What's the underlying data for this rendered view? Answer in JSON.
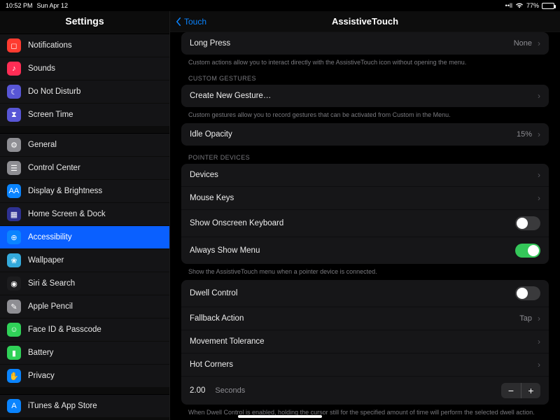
{
  "status": {
    "time": "10:52 PM",
    "date": "Sun Apr 12",
    "battery": "77%"
  },
  "sidebar": {
    "title": "Settings",
    "groups": [
      {
        "items": [
          {
            "label": "Notifications",
            "icon_bg": "#ff3b30",
            "glyph": "◻︎"
          },
          {
            "label": "Sounds",
            "icon_bg": "#ff2d55",
            "glyph": "♪"
          },
          {
            "label": "Do Not Disturb",
            "icon_bg": "#5856d6",
            "glyph": "☾"
          },
          {
            "label": "Screen Time",
            "icon_bg": "#5856d6",
            "glyph": "⧗"
          }
        ]
      },
      {
        "items": [
          {
            "label": "General",
            "icon_bg": "#8e8e93",
            "glyph": "⚙"
          },
          {
            "label": "Control Center",
            "icon_bg": "#8e8e93",
            "glyph": "☰"
          },
          {
            "label": "Display & Brightness",
            "icon_bg": "#0a84ff",
            "glyph": "AA"
          },
          {
            "label": "Home Screen & Dock",
            "icon_bg": "#2e3192",
            "glyph": "▦"
          },
          {
            "label": "Accessibility",
            "icon_bg": "#0a84ff",
            "glyph": "⊕",
            "selected": true
          },
          {
            "label": "Wallpaper",
            "icon_bg": "#34aadc",
            "glyph": "❀"
          },
          {
            "label": "Siri & Search",
            "icon_bg": "#1c1c1e",
            "glyph": "◉"
          },
          {
            "label": "Apple Pencil",
            "icon_bg": "#8e8e93",
            "glyph": "✎"
          },
          {
            "label": "Face ID & Passcode",
            "icon_bg": "#30d158",
            "glyph": "☺"
          },
          {
            "label": "Battery",
            "icon_bg": "#30d158",
            "glyph": "▮"
          },
          {
            "label": "Privacy",
            "icon_bg": "#0a84ff",
            "glyph": "✋"
          }
        ]
      },
      {
        "items": [
          {
            "label": "iTunes & App Store",
            "icon_bg": "#0a84ff",
            "glyph": "A"
          }
        ]
      }
    ]
  },
  "detail": {
    "back_label": "Touch",
    "title": "AssistiveTouch",
    "rows": {
      "long_press": {
        "label": "Long Press",
        "value": "None"
      },
      "lp_footer": "Custom actions allow you to interact directly with the AssistiveTouch icon without opening the menu.",
      "custom_gestures_header": "CUSTOM GESTURES",
      "create_gesture": {
        "label": "Create New Gesture…"
      },
      "cg_footer": "Custom gestures allow you to record gestures that can be activated from Custom in the Menu.",
      "idle_opacity": {
        "label": "Idle Opacity",
        "value": "15%"
      },
      "pointer_header": "POINTER DEVICES",
      "devices": {
        "label": "Devices"
      },
      "mouse_keys": {
        "label": "Mouse Keys"
      },
      "onscreen_kb": {
        "label": "Show Onscreen Keyboard",
        "on": false
      },
      "always_menu": {
        "label": "Always Show Menu",
        "on": true
      },
      "pointer_footer": "Show the AssistiveTouch menu when a pointer device is connected.",
      "dwell": {
        "label": "Dwell Control",
        "on": false
      },
      "fallback": {
        "label": "Fallback Action",
        "value": "Tap"
      },
      "movement": {
        "label": "Movement Tolerance"
      },
      "hot_corners": {
        "label": "Hot Corners"
      },
      "seconds": {
        "value": "2.00",
        "unit": "Seconds"
      },
      "dwell_footer": "When Dwell Control is enabled, holding the cursor still for the specified amount of time will perform the selected dwell action."
    }
  }
}
